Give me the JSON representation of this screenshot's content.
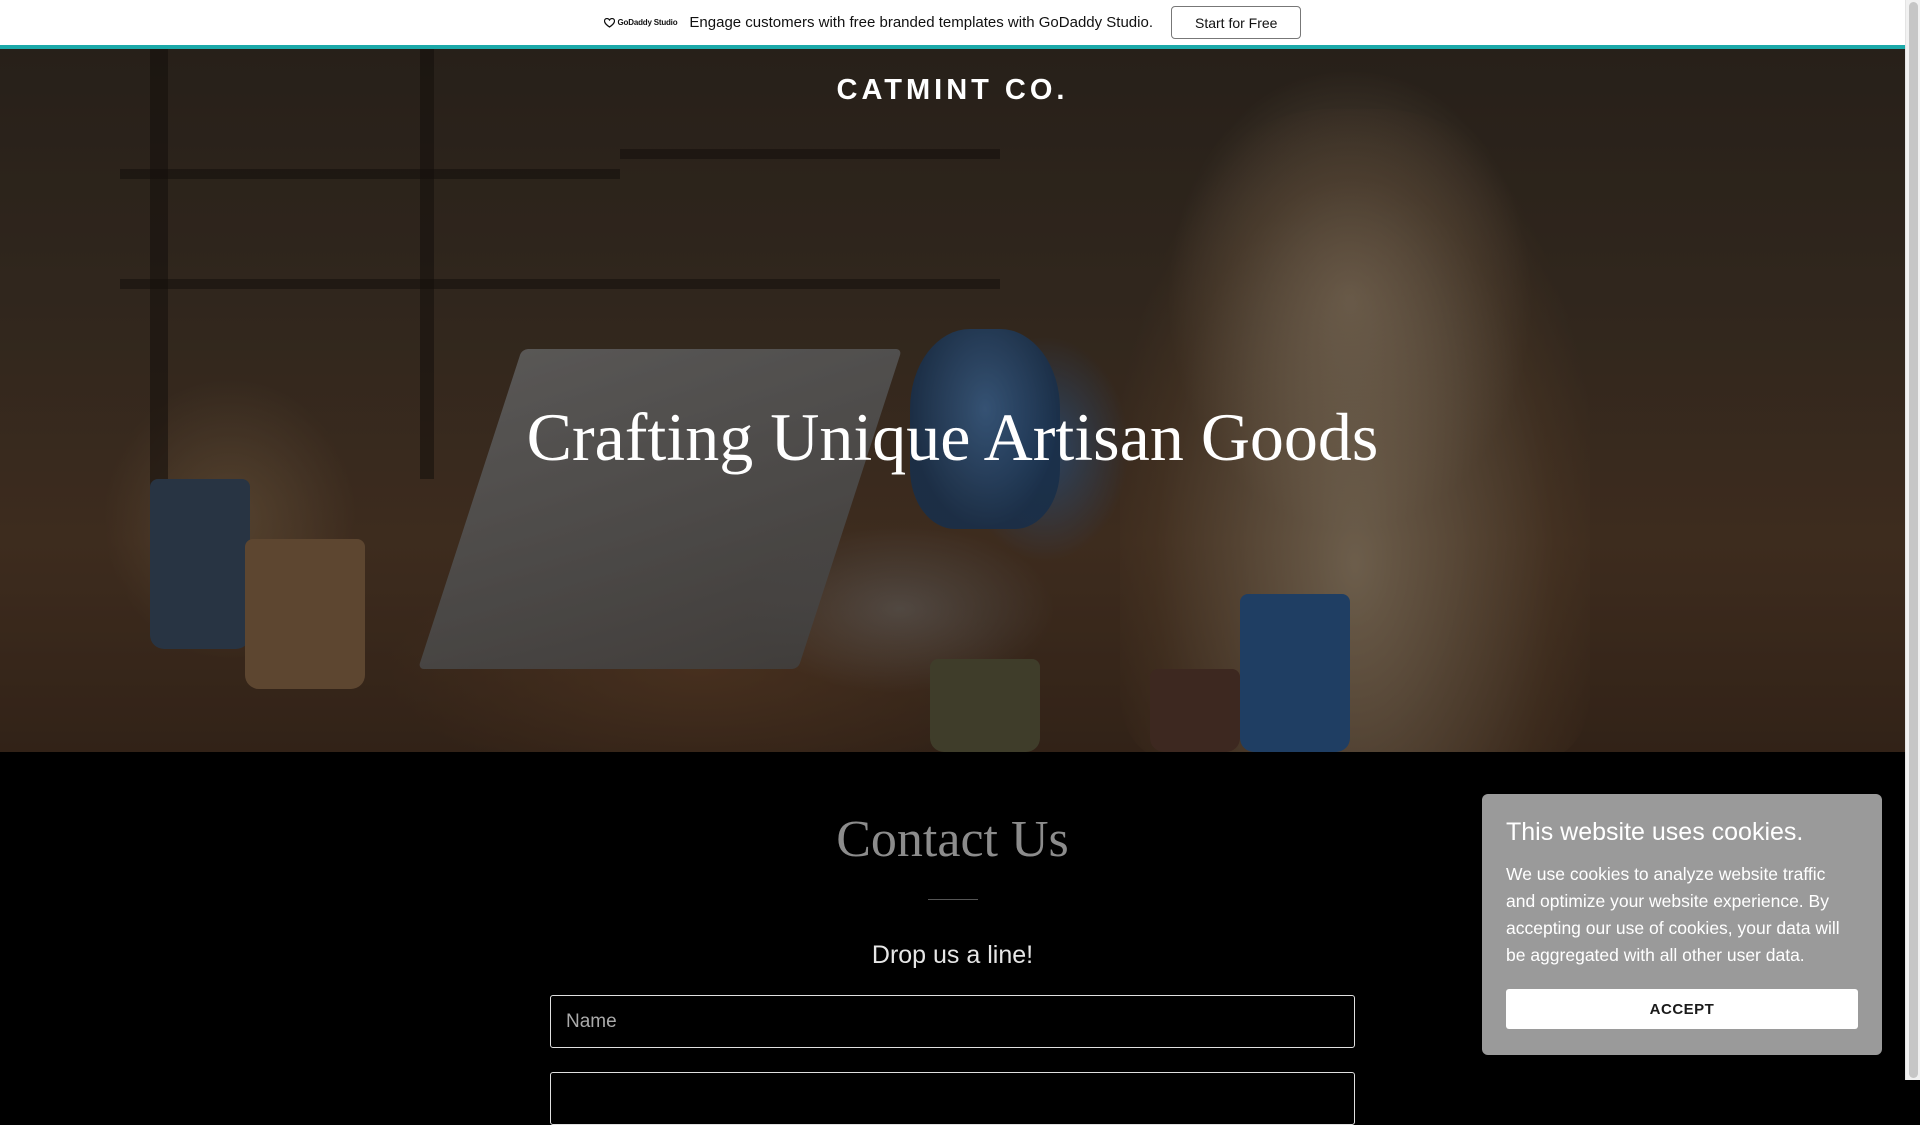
{
  "promo": {
    "logo_text": "GoDaddy Studio",
    "message": "Engage customers with free branded templates with GoDaddy Studio.",
    "cta_label": "Start for Free",
    "accent_color": "#1ba9a9"
  },
  "hero": {
    "brand": "CATMINT CO.",
    "title": "Crafting Unique Artisan Goods"
  },
  "contact": {
    "title": "Contact Us",
    "subtitle": "Drop us a line!",
    "name_placeholder": "Name"
  },
  "cookie_banner": {
    "title": "This website uses cookies.",
    "body": "We use cookies to analyze website traffic and optimize your website experience. By accepting our use of cookies, your data will be aggregated with all other user data.",
    "accept_label": "ACCEPT"
  }
}
